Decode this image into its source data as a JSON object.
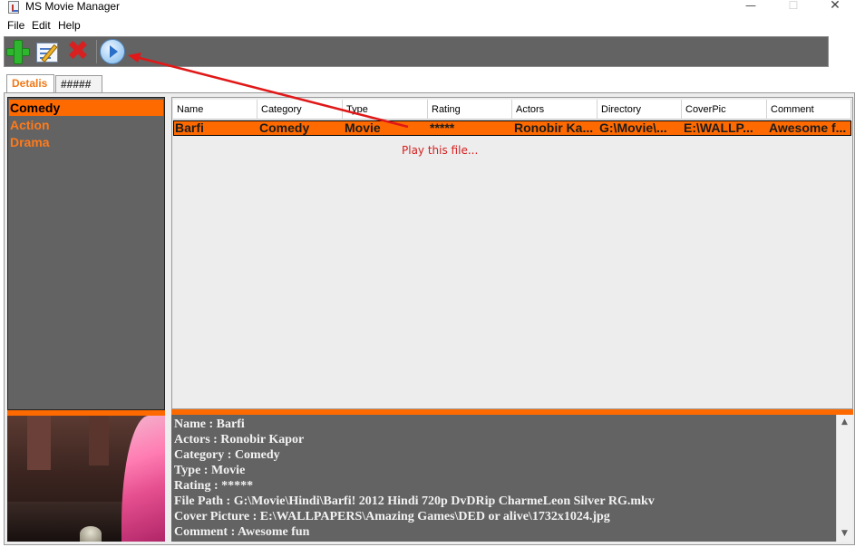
{
  "window": {
    "title": "MS Movie Manager",
    "controls": {
      "minimize": "—",
      "maximize": "☐",
      "close": "✕"
    }
  },
  "menu": [
    "File",
    "Edit",
    "Help"
  ],
  "toolbar": {
    "buttons": [
      {
        "icon": "add-icon"
      },
      {
        "icon": "edit-icon"
      },
      {
        "icon": "delete-icon"
      },
      {
        "icon": "play-icon"
      }
    ]
  },
  "tabs": [
    "Detalis",
    "#####"
  ],
  "categories": [
    {
      "label": "Comedy",
      "selected": true
    },
    {
      "label": "Action",
      "selected": false
    },
    {
      "label": "Drama",
      "selected": false
    }
  ],
  "table": {
    "columns": [
      "Name",
      "Category",
      "Type",
      "Rating",
      "Actors",
      "Directory",
      "CoverPic",
      "Comment"
    ],
    "rows": [
      [
        "Barfi",
        "Comedy",
        "Movie",
        "*****",
        "Ronobir Ka...",
        "G:\\Movie\\...",
        "E:\\WALLP...",
        "Awesome f..."
      ]
    ]
  },
  "annotation": "Play this file...",
  "details": [
    "Name : Barfi",
    "Actors : Ronobir Kapor",
    "Category : Comedy",
    "Type : Movie",
    "Rating : *****",
    "File Path : G:\\Movie\\Hindi\\Barfi! 2012 Hindi 720p DvDRip CharmeLeon Silver RG.mkv",
    "Cover Picture : E:\\WALLPAPERS\\Amazing Games\\DED or alive\\1732x1024.jpg",
    "Comment : Awesome fun"
  ],
  "colors": {
    "accent": "#ff6a00",
    "panel": "#636363",
    "annotation": "#d42020"
  }
}
